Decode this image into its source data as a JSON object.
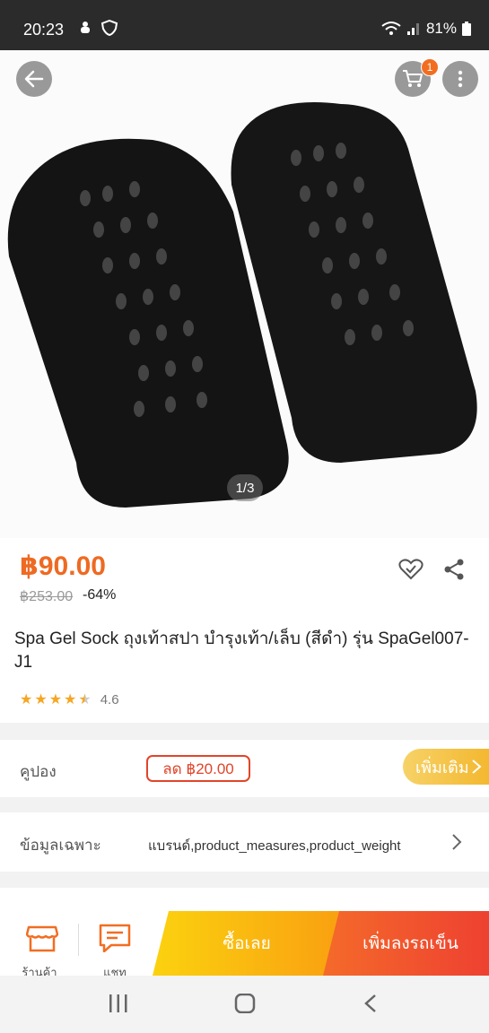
{
  "status_bar": {
    "time": "20:23",
    "battery": "81%"
  },
  "header": {
    "cart_count": "1"
  },
  "gallery": {
    "counter": "1/3"
  },
  "product": {
    "price": "฿90.00",
    "original_price": "฿253.00",
    "discount": "-64%",
    "title": "Spa Gel Sock ถุงเท้าสปา บำรุงเท้า/เล็บ (สีดำ) รุ่น SpaGel007-J1",
    "rating": "4.6",
    "stars_filled": 4.5
  },
  "coupon": {
    "label": "คูปอง",
    "tag": "ลด ฿20.00",
    "more": "เพิ่มเติม"
  },
  "specs": {
    "label": "ข้อมูลเฉพาะ",
    "value": "แบรนด์,product_measures,product_weight"
  },
  "bottom_bar": {
    "shop": "ร้านค้า",
    "chat": "แชท",
    "buy_now": "ซื้อเลย",
    "add_to_cart": "เพิ่มลงรถเข็น"
  },
  "colors": {
    "accent": "#ee6a22",
    "buy_now": "#fbd20f",
    "add_cart": "#ee4131",
    "star": "#f5a623"
  }
}
